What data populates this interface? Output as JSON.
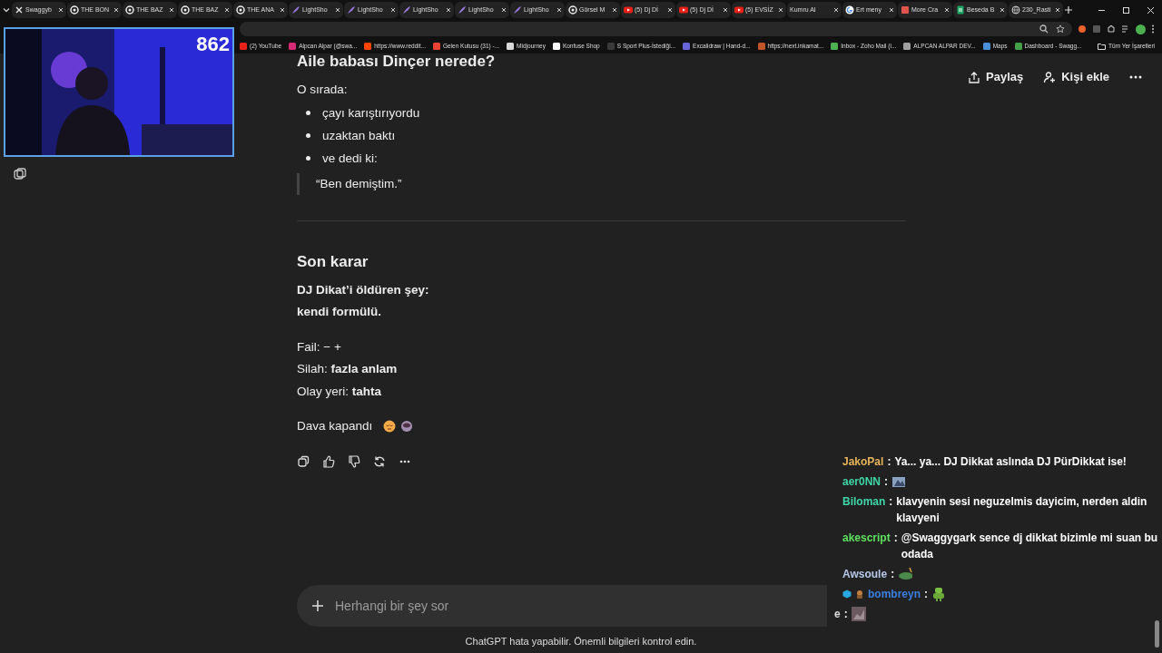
{
  "tabs": [
    {
      "label": "Swaggyb",
      "kind": "x"
    },
    {
      "label": "THE BON",
      "kind": "openai"
    },
    {
      "label": "THE BAZ",
      "kind": "openai"
    },
    {
      "label": "THE BAZ",
      "kind": "openai"
    },
    {
      "label": "THE ANA",
      "kind": "openai"
    },
    {
      "label": "LightSho",
      "kind": "feather"
    },
    {
      "label": "LightSho",
      "kind": "feather"
    },
    {
      "label": "LightSho",
      "kind": "feather"
    },
    {
      "label": "LightSho",
      "kind": "feather"
    },
    {
      "label": "LightSho",
      "kind": "feather"
    },
    {
      "label": "Görsel M",
      "kind": "openai"
    },
    {
      "label": "(5) Dj Dİ",
      "kind": "youtube"
    },
    {
      "label": "(5) Dj Dİ",
      "kind": "youtube"
    },
    {
      "label": "(5) EVSİZ",
      "kind": "youtube"
    },
    {
      "label": "Kumru AI",
      "kind": "blank"
    },
    {
      "label": "Ert meny",
      "kind": "google"
    },
    {
      "label": "More Cra",
      "kind": "red"
    },
    {
      "label": "Beseda B",
      "kind": "sheet"
    },
    {
      "label": "230_Rasti",
      "kind": "globe"
    }
  ],
  "bookmarks": [
    {
      "label": "(2) YouTube",
      "color": "#e62117"
    },
    {
      "label": "Alpcan Alpar (@swa...",
      "color": "#d62976"
    },
    {
      "label": "https://www.reddit...",
      "color": "#ff4500"
    },
    {
      "label": "Gelen Kutusu (31) -...",
      "color": "#ea4335"
    },
    {
      "label": "Midjourney",
      "color": "#d9d9d9"
    },
    {
      "label": "Konfuse Shop",
      "color": "#ffffff"
    },
    {
      "label": "S Sport Plus-İstediği...",
      "color": "#3a3a3a"
    },
    {
      "label": "Excalidraw | Hand-d...",
      "color": "#6965db"
    },
    {
      "label": "https://next.inkamat...",
      "color": "#c0552a"
    },
    {
      "label": "Inbox - Zoho Mail (i...",
      "color": "#4caf50"
    },
    {
      "label": "ALPCAN ALPAR DEV...",
      "color": "#9e9e9e"
    },
    {
      "label": "Maps",
      "color": "#4a90d9"
    },
    {
      "label": "Dashboard - Swagg...",
      "color": "#43a047"
    }
  ],
  "all_bookmarks": "Tüm Yer İşaretleri",
  "webcam": {
    "counter": "862"
  },
  "header_actions": [
    {
      "label": "Paylaş",
      "kind": "share"
    },
    {
      "label": "Kişi ekle",
      "kind": "add-person"
    }
  ],
  "blocks": [
    {
      "kind": "heading",
      "text": "Aile babası Dinçer nerede?"
    },
    {
      "kind": "para",
      "text": "O sırada:"
    },
    {
      "kind": "bullet",
      "text": "çayı karıştırıyordu"
    },
    {
      "kind": "bullet",
      "text": "uzaktan baktı"
    },
    {
      "kind": "bullet",
      "text": "ve dedi ki:"
    },
    {
      "kind": "quote",
      "text": "“Ben demiştim.”"
    },
    {
      "kind": "rule"
    },
    {
      "kind": "heading",
      "text": "Son karar"
    },
    {
      "kind": "strong",
      "text": "DJ Dikat’i öldüren şey:"
    },
    {
      "kind": "strong",
      "text": "kendi formülü."
    },
    {
      "kind": "gap"
    },
    {
      "kind": "para",
      "text": "Fail: − +"
    },
    {
      "kind": "para",
      "text": "Silah: **fazla anlam**"
    },
    {
      "kind": "para",
      "text": "Olay yeri: **tahta**"
    },
    {
      "kind": "gap"
    },
    {
      "kind": "emoji_para",
      "text": "Dava kapandı"
    }
  ],
  "composer": {
    "placeholder": "Herhangi bir şey sor"
  },
  "footer": "ChatGPT hata yapabilir. Önemli bilgileri kontrol edin.",
  "chat": [
    {
      "user": "JakoPal",
      "color": "#e8b45a",
      "separator": ":",
      "kind": "text",
      "text": "Ya... ya... DJ Dikkat aslında DJ PürDikkat ise!"
    },
    {
      "user": "aer0NN",
      "color": "#3fd6a8",
      "separator": ":",
      "kind": "emote"
    },
    {
      "user": "Biloman",
      "color": "#3fd6a8",
      "separator": ":",
      "kind": "text",
      "text": "klavyenin sesi neguzelmis dayicim, nerden aldin klavyeni"
    },
    {
      "user": "akescript",
      "color": "#5fe05f",
      "separator": ":",
      "kind": "text",
      "text": "@Swaggygark sence dj dikkat bizimle mi suan bu odada"
    },
    {
      "user": "Awsoule",
      "color": "#b8c8e8",
      "separator": ":",
      "kind": "emote"
    },
    {
      "user": "bombreyn",
      "color": "#3b7fe0",
      "separator": ":",
      "kind": "emote",
      "badges": true
    },
    {
      "user": "e",
      "color": "#dddddd",
      "separator": ":",
      "kind": "emote"
    }
  ]
}
